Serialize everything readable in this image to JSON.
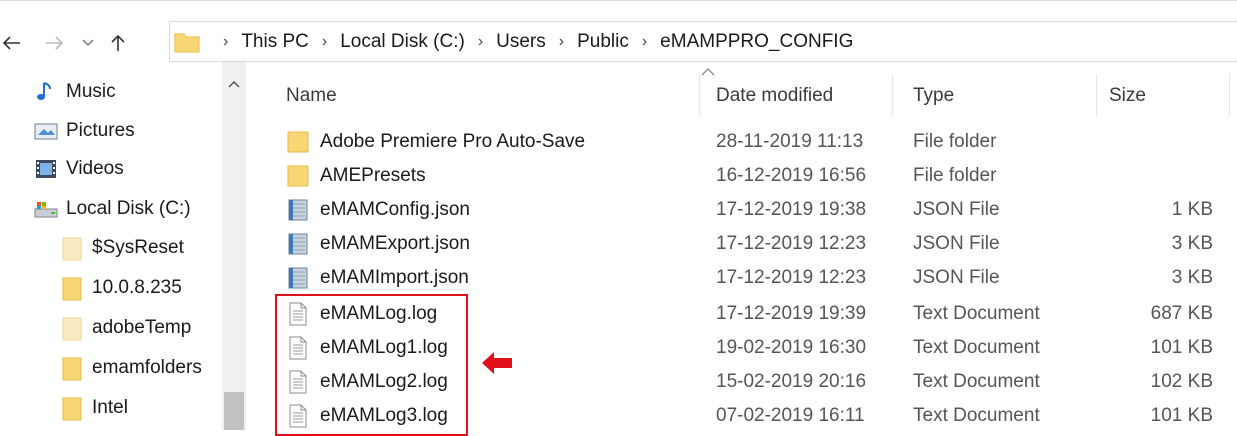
{
  "breadcrumb": [
    "This PC",
    "Local Disk (C:)",
    "Users",
    "Public",
    "eMAMPPRO_CONFIG"
  ],
  "nav_items": [
    {
      "label": "Music",
      "icon": "music-icon"
    },
    {
      "label": "Pictures",
      "icon": "pictures-icon"
    },
    {
      "label": "Videos",
      "icon": "videos-icon"
    },
    {
      "label": "Local Disk (C:)",
      "icon": "drive-icon"
    },
    {
      "label": "$SysReset",
      "icon": "folder-icon"
    },
    {
      "label": "10.0.8.235",
      "icon": "folder-icon"
    },
    {
      "label": "adobeTemp",
      "icon": "folder-icon"
    },
    {
      "label": "emamfolders",
      "icon": "folder-icon"
    },
    {
      "label": "Intel",
      "icon": "folder-icon"
    }
  ],
  "columns": {
    "name": "Name",
    "date": "Date modified",
    "type": "Type",
    "size": "Size"
  },
  "files": [
    {
      "name": "Adobe Premiere Pro Auto-Save",
      "date": "28-11-2019 11:13",
      "type": "File folder",
      "size": "",
      "icon": "folder-icon"
    },
    {
      "name": "AMEPresets",
      "date": "16-12-2019 16:56",
      "type": "File folder",
      "size": "",
      "icon": "folder-icon"
    },
    {
      "name": "eMAMConfig.json",
      "date": "17-12-2019 19:38",
      "type": "JSON File",
      "size": "1 KB",
      "icon": "json-file-icon"
    },
    {
      "name": "eMAMExport.json",
      "date": "17-12-2019 12:23",
      "type": "JSON File",
      "size": "3 KB",
      "icon": "json-file-icon"
    },
    {
      "name": "eMAMImport.json",
      "date": "17-12-2019 12:23",
      "type": "JSON File",
      "size": "3 KB",
      "icon": "json-file-icon"
    },
    {
      "name": "eMAMLog.log",
      "date": "17-12-2019 19:39",
      "type": "Text Document",
      "size": "687 KB",
      "icon": "text-file-icon"
    },
    {
      "name": "eMAMLog1.log",
      "date": "19-02-2019 16:30",
      "type": "Text Document",
      "size": "101 KB",
      "icon": "text-file-icon"
    },
    {
      "name": "eMAMLog2.log",
      "date": "15-02-2019 20:16",
      "type": "Text Document",
      "size": "102 KB",
      "icon": "text-file-icon"
    },
    {
      "name": "eMAMLog3.log",
      "date": "07-02-2019 16:11",
      "type": "Text Document",
      "size": "101 KB",
      "icon": "text-file-icon"
    }
  ],
  "colors": {
    "highlight_box": "#e0101a",
    "folder": "#f8d775",
    "folder_dark": "#e8b84a"
  }
}
